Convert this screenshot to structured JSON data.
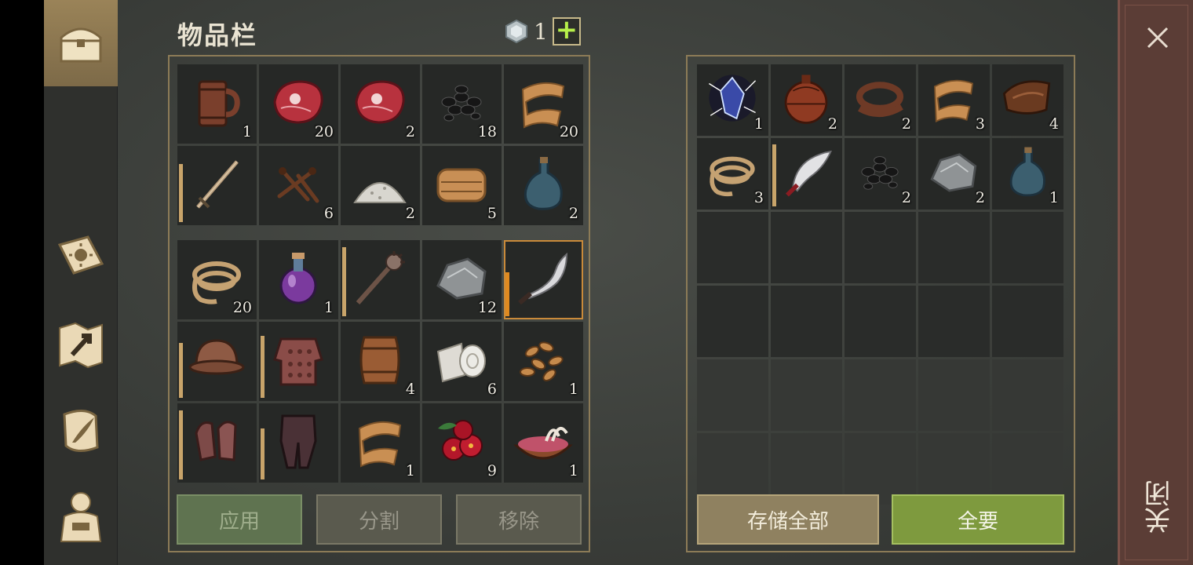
{
  "inventory": {
    "title": "物品栏",
    "currency_value": "1",
    "add_label": "+",
    "grid_top": [
      {
        "icon": "mug-icon",
        "count": "1"
      },
      {
        "icon": "raw-meat-icon",
        "count": "20"
      },
      {
        "icon": "raw-meat-icon",
        "count": "2"
      },
      {
        "icon": "coal-icon",
        "count": "18"
      },
      {
        "icon": "cloth-scrap-icon",
        "count": "20"
      },
      {
        "icon": "sword-icon",
        "count": "",
        "durability": 0.8
      },
      {
        "icon": "nails-icon",
        "count": "6"
      },
      {
        "icon": "salt-icon",
        "count": "2"
      },
      {
        "icon": "fabric-icon",
        "count": "5"
      },
      {
        "icon": "bottle-icon",
        "count": "2"
      }
    ],
    "grid_bottom": [
      {
        "icon": "rope-icon",
        "count": "20"
      },
      {
        "icon": "potion-icon",
        "count": "1"
      },
      {
        "icon": "mace-icon",
        "count": "",
        "durability": 0.95
      },
      {
        "icon": "stone-icon",
        "count": "12"
      },
      {
        "icon": "curved-blade-icon",
        "count": "",
        "durability": 0.6,
        "selected": true
      },
      {
        "icon": "helmet-icon",
        "count": "",
        "durability": 0.75
      },
      {
        "icon": "chainmail-icon",
        "count": "",
        "durability": 0.85
      },
      {
        "icon": "barrel-icon",
        "count": "4"
      },
      {
        "icon": "bandage-roll-icon",
        "count": "6"
      },
      {
        "icon": "seeds-icon",
        "count": "1"
      },
      {
        "icon": "gloves-icon",
        "count": "",
        "durability": 0.95
      },
      {
        "icon": "leggings-icon",
        "count": "",
        "durability": 0.7
      },
      {
        "icon": "cloth-scrap-icon",
        "count": "1"
      },
      {
        "icon": "berries-icon",
        "count": "9"
      },
      {
        "icon": "meat-bowl-icon",
        "count": "1"
      }
    ],
    "buttons": {
      "apply": "应用",
      "split": "分割",
      "remove": "移除"
    }
  },
  "storage": {
    "items": [
      {
        "icon": "crystal-icon",
        "count": "1"
      },
      {
        "icon": "leather-flask-icon",
        "count": "2"
      },
      {
        "icon": "leather-strip-icon",
        "count": "2"
      },
      {
        "icon": "cloth-scrap-icon",
        "count": "3"
      },
      {
        "icon": "leather-icon",
        "count": "4"
      },
      {
        "icon": "rope-icon",
        "count": "3"
      },
      {
        "icon": "scimitar-icon",
        "count": "",
        "durability": 0.95
      },
      {
        "icon": "coal-icon",
        "count": "2"
      },
      {
        "icon": "stone-icon",
        "count": "2"
      },
      {
        "icon": "bottle-icon",
        "count": "1"
      }
    ],
    "buttons": {
      "store_all": "存储全部",
      "take_all": "全要"
    }
  },
  "close_label": "关闭",
  "nav": [
    "chest-icon",
    "sun-book-icon",
    "map-icon",
    "scroll-quill-icon",
    "character-icon"
  ]
}
